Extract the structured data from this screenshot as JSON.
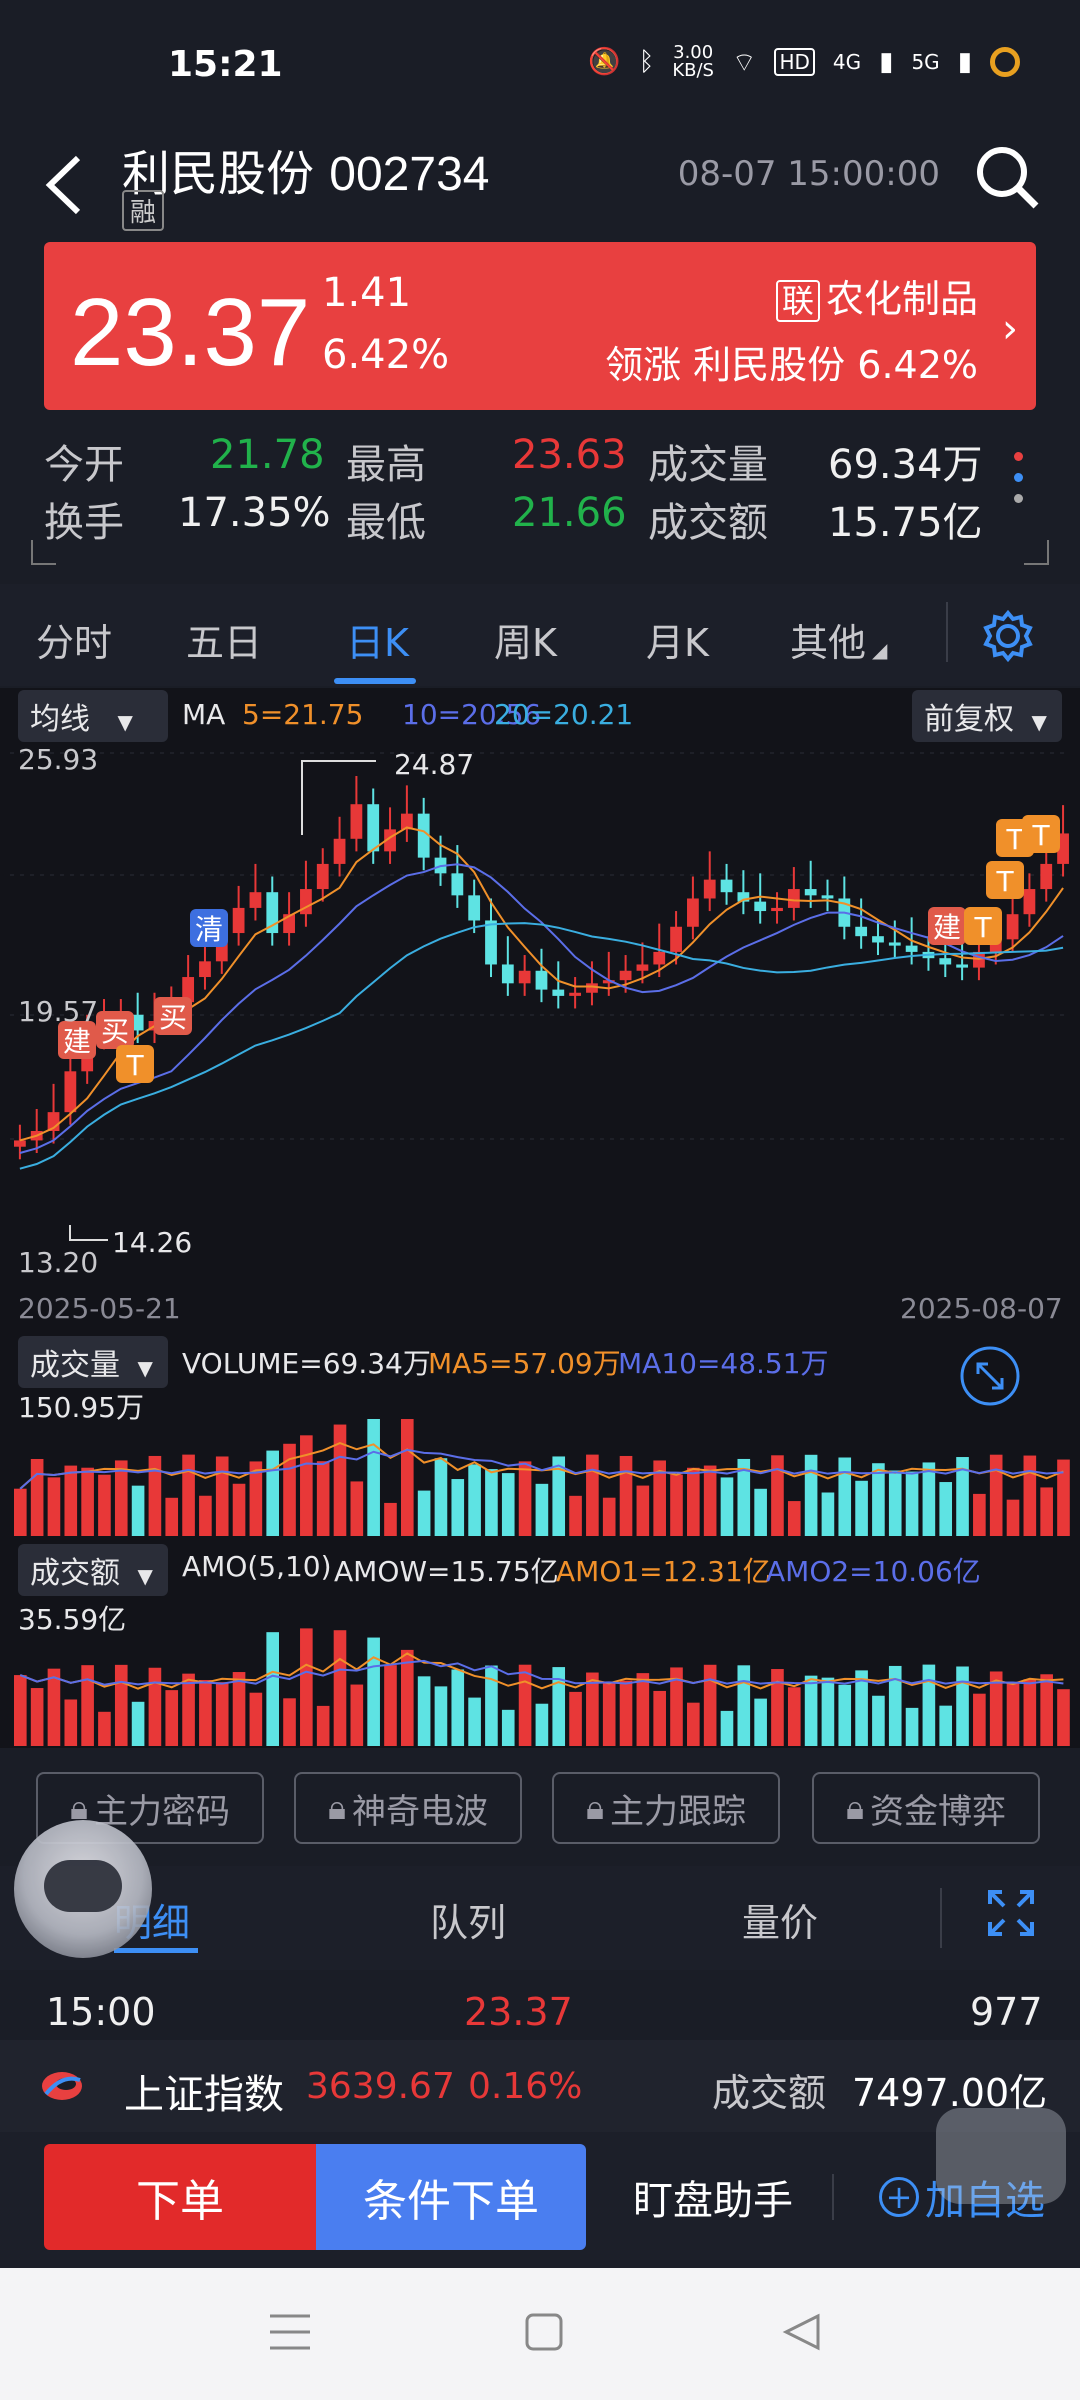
{
  "status": {
    "time": "15:21",
    "speed": "3.00",
    "speed_unit": "KB/S",
    "hd": "HD",
    "sig1": "4G",
    "sig2": "5G"
  },
  "header": {
    "stock_name": "利民股份",
    "stock_code": "002734",
    "badge": "融",
    "datetime": "08-07 15:00:00"
  },
  "quote": {
    "price": "23.37",
    "change": "1.41",
    "change_pct": "6.42%",
    "sector_badge": "联",
    "sector": "农化制品",
    "lead_label": "领涨",
    "lead_stock": "利民股份",
    "lead_pct": "6.42%"
  },
  "stats": {
    "open_label": "今开",
    "open": "21.78",
    "high_label": "最高",
    "high": "23.63",
    "vol_label": "成交量",
    "vol": "69.34万",
    "turnover_label": "换手",
    "turnover": "17.35%",
    "low_label": "最低",
    "low": "21.66",
    "amt_label": "成交额",
    "amt": "15.75亿"
  },
  "tabs": [
    "分时",
    "五日",
    "日K",
    "周K",
    "月K",
    "其他"
  ],
  "kchart": {
    "indicator": "均线",
    "ma_label": "MA",
    "ma5": "5=21.75",
    "ma10": "10=20.56",
    "ma20": "20=20.21",
    "adjust": "前复权",
    "y_top": "25.93",
    "y_mid": "19.57",
    "y_low": "13.20",
    "peak": "24.87",
    "trough": "14.26",
    "date_start": "2025-05-21",
    "date_end": "2025-08-07",
    "tags": [
      "建",
      "买",
      "T",
      "买",
      "清",
      "建",
      "T",
      "T",
      "T",
      "T"
    ]
  },
  "volume": {
    "label": "成交量",
    "value": "VOLUME=69.34万",
    "ma5": "MA5=57.09万",
    "ma10": "MA10=48.51万",
    "max": "150.95万"
  },
  "amount": {
    "label": "成交额",
    "formula": "AMO(5,10)",
    "amow": "AMOW=15.75亿",
    "amo1": "AMO1=12.31亿",
    "amo2": "AMO2=10.06亿",
    "max": "35.59亿"
  },
  "functions": [
    "主力密码",
    "神奇电波",
    "主力跟踪",
    "资金博弈"
  ],
  "detail_tabs": [
    "明细",
    "队列",
    "量价"
  ],
  "detail_row": {
    "time": "15:00",
    "price": "23.37",
    "volume": "977"
  },
  "index": {
    "name": "上证指数",
    "value": "3639.67",
    "pct": "0.16%",
    "amt_label": "成交额",
    "amt": "7497.00亿"
  },
  "actions": {
    "order": "下单",
    "cond_order": "条件下单",
    "assistant": "盯盘助手",
    "add_watch": "加自选"
  },
  "colors": {
    "up": "#e83838",
    "down": "#5ee3e3",
    "ma5": "#f0902a",
    "ma10": "#5b6ee8",
    "ma20": "#3aaee0",
    "accent": "#3d8ff5"
  }
}
